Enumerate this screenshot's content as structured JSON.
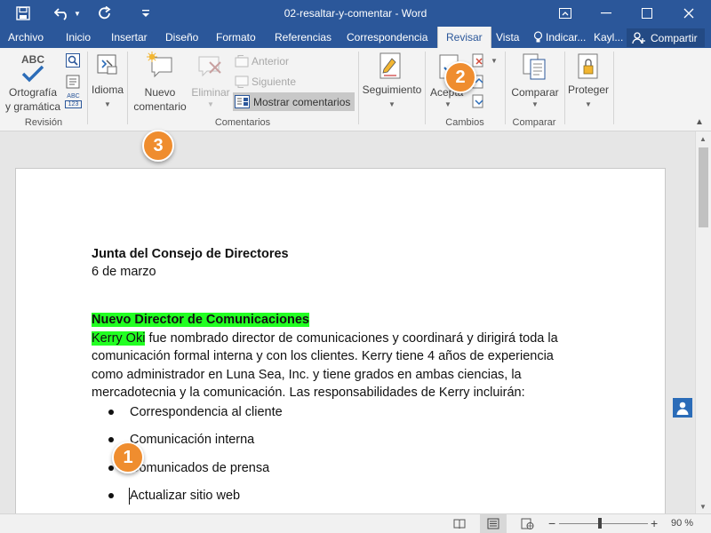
{
  "window": {
    "title": "02-resaltar-y-comentar  -  Word",
    "quick_access": [
      "save-icon",
      "undo-icon",
      "redo-icon",
      "customize-icon"
    ]
  },
  "tabs": [
    {
      "label": "Archivo"
    },
    {
      "label": "Inicio"
    },
    {
      "label": "Insertar"
    },
    {
      "label": "Diseño"
    },
    {
      "label": "Formato"
    },
    {
      "label": "Referencias"
    },
    {
      "label": "Correspondencia"
    },
    {
      "label": "Revisar",
      "active": true
    },
    {
      "label": "Vista"
    }
  ],
  "tell_me": "Indicar...",
  "user": "Kayl...",
  "share": "Compartir",
  "ribbon": {
    "revision": {
      "group": "Revisión",
      "spelling_line1": "Ortografía",
      "spelling_line2": "y gramática",
      "abc": "ABC",
      "abc_small": "ABC",
      "abc_num": "123"
    },
    "idioma": "Idioma",
    "comentarios": {
      "group": "Comentarios",
      "new_line1": "Nuevo",
      "new_line2": "comentario",
      "delete": "Eliminar",
      "previous": "Anterior",
      "next": "Siguiente",
      "show": "Mostrar comentarios"
    },
    "seguimiento": "Seguimiento",
    "cambios": {
      "group": "Cambios",
      "accept": "Acepta"
    },
    "comparar": {
      "group": "Comparar",
      "compare": "Comparar"
    },
    "proteger": "Proteger"
  },
  "badges": [
    "1",
    "2",
    "3"
  ],
  "document": {
    "title": "Junta del Consejo de Directores",
    "date": "6 de marzo",
    "heading": "Nuevo Director de Comunicaciones",
    "para_highlight": "Kerry Oki",
    "para_line1": " fue nombrado director de comunicaciones y coordinará y dirigirá toda la",
    "para_line2": "comunicación formal interna y con los clientes. Kerry tiene 4 años de experiencia",
    "para_line3": "como administrador en Luna Sea, Inc. y tiene grados en ambas ciencias, la",
    "para_line4": "mercadotecnia y la comunicación. Las responsabilidades de Kerry incluirán:",
    "bullets": [
      "Correspondencia al cliente",
      "Comunicación interna",
      "Comunicados de prensa",
      "Actualizar sitio web"
    ]
  },
  "status": {
    "zoom": "90 %"
  },
  "colors": {
    "word_blue": "#2b579a",
    "highlight": "#22ff22",
    "badge_orange": "#ef8d2f"
  }
}
